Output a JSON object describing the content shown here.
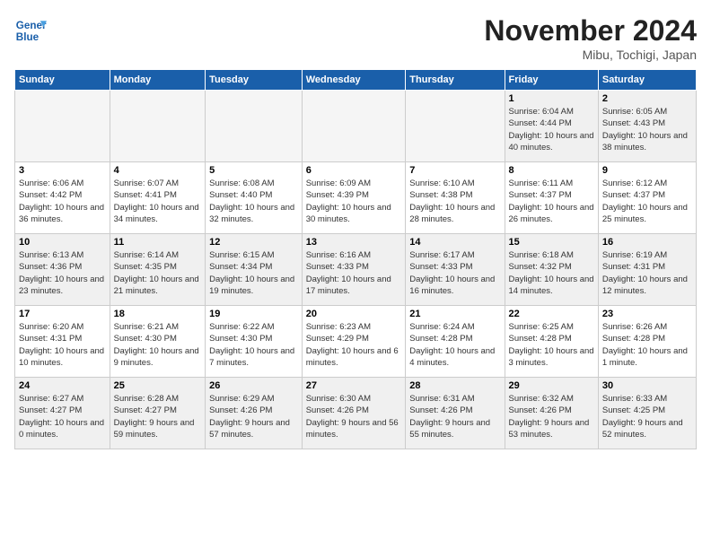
{
  "header": {
    "logo_line1": "General",
    "logo_line2": "Blue",
    "month_title": "November 2024",
    "location": "Mibu, Tochigi, Japan"
  },
  "weekdays": [
    "Sunday",
    "Monday",
    "Tuesday",
    "Wednesday",
    "Thursday",
    "Friday",
    "Saturday"
  ],
  "weeks": [
    [
      {
        "day": "",
        "info": ""
      },
      {
        "day": "",
        "info": ""
      },
      {
        "day": "",
        "info": ""
      },
      {
        "day": "",
        "info": ""
      },
      {
        "day": "",
        "info": ""
      },
      {
        "day": "1",
        "info": "Sunrise: 6:04 AM\nSunset: 4:44 PM\nDaylight: 10 hours and 40 minutes."
      },
      {
        "day": "2",
        "info": "Sunrise: 6:05 AM\nSunset: 4:43 PM\nDaylight: 10 hours and 38 minutes."
      }
    ],
    [
      {
        "day": "3",
        "info": "Sunrise: 6:06 AM\nSunset: 4:42 PM\nDaylight: 10 hours and 36 minutes."
      },
      {
        "day": "4",
        "info": "Sunrise: 6:07 AM\nSunset: 4:41 PM\nDaylight: 10 hours and 34 minutes."
      },
      {
        "day": "5",
        "info": "Sunrise: 6:08 AM\nSunset: 4:40 PM\nDaylight: 10 hours and 32 minutes."
      },
      {
        "day": "6",
        "info": "Sunrise: 6:09 AM\nSunset: 4:39 PM\nDaylight: 10 hours and 30 minutes."
      },
      {
        "day": "7",
        "info": "Sunrise: 6:10 AM\nSunset: 4:38 PM\nDaylight: 10 hours and 28 minutes."
      },
      {
        "day": "8",
        "info": "Sunrise: 6:11 AM\nSunset: 4:37 PM\nDaylight: 10 hours and 26 minutes."
      },
      {
        "day": "9",
        "info": "Sunrise: 6:12 AM\nSunset: 4:37 PM\nDaylight: 10 hours and 25 minutes."
      }
    ],
    [
      {
        "day": "10",
        "info": "Sunrise: 6:13 AM\nSunset: 4:36 PM\nDaylight: 10 hours and 23 minutes."
      },
      {
        "day": "11",
        "info": "Sunrise: 6:14 AM\nSunset: 4:35 PM\nDaylight: 10 hours and 21 minutes."
      },
      {
        "day": "12",
        "info": "Sunrise: 6:15 AM\nSunset: 4:34 PM\nDaylight: 10 hours and 19 minutes."
      },
      {
        "day": "13",
        "info": "Sunrise: 6:16 AM\nSunset: 4:33 PM\nDaylight: 10 hours and 17 minutes."
      },
      {
        "day": "14",
        "info": "Sunrise: 6:17 AM\nSunset: 4:33 PM\nDaylight: 10 hours and 16 minutes."
      },
      {
        "day": "15",
        "info": "Sunrise: 6:18 AM\nSunset: 4:32 PM\nDaylight: 10 hours and 14 minutes."
      },
      {
        "day": "16",
        "info": "Sunrise: 6:19 AM\nSunset: 4:31 PM\nDaylight: 10 hours and 12 minutes."
      }
    ],
    [
      {
        "day": "17",
        "info": "Sunrise: 6:20 AM\nSunset: 4:31 PM\nDaylight: 10 hours and 10 minutes."
      },
      {
        "day": "18",
        "info": "Sunrise: 6:21 AM\nSunset: 4:30 PM\nDaylight: 10 hours and 9 minutes."
      },
      {
        "day": "19",
        "info": "Sunrise: 6:22 AM\nSunset: 4:30 PM\nDaylight: 10 hours and 7 minutes."
      },
      {
        "day": "20",
        "info": "Sunrise: 6:23 AM\nSunset: 4:29 PM\nDaylight: 10 hours and 6 minutes."
      },
      {
        "day": "21",
        "info": "Sunrise: 6:24 AM\nSunset: 4:28 PM\nDaylight: 10 hours and 4 minutes."
      },
      {
        "day": "22",
        "info": "Sunrise: 6:25 AM\nSunset: 4:28 PM\nDaylight: 10 hours and 3 minutes."
      },
      {
        "day": "23",
        "info": "Sunrise: 6:26 AM\nSunset: 4:28 PM\nDaylight: 10 hours and 1 minute."
      }
    ],
    [
      {
        "day": "24",
        "info": "Sunrise: 6:27 AM\nSunset: 4:27 PM\nDaylight: 10 hours and 0 minutes."
      },
      {
        "day": "25",
        "info": "Sunrise: 6:28 AM\nSunset: 4:27 PM\nDaylight: 9 hours and 59 minutes."
      },
      {
        "day": "26",
        "info": "Sunrise: 6:29 AM\nSunset: 4:26 PM\nDaylight: 9 hours and 57 minutes."
      },
      {
        "day": "27",
        "info": "Sunrise: 6:30 AM\nSunset: 4:26 PM\nDaylight: 9 hours and 56 minutes."
      },
      {
        "day": "28",
        "info": "Sunrise: 6:31 AM\nSunset: 4:26 PM\nDaylight: 9 hours and 55 minutes."
      },
      {
        "day": "29",
        "info": "Sunrise: 6:32 AM\nSunset: 4:26 PM\nDaylight: 9 hours and 53 minutes."
      },
      {
        "day": "30",
        "info": "Sunrise: 6:33 AM\nSunset: 4:25 PM\nDaylight: 9 hours and 52 minutes."
      }
    ]
  ]
}
